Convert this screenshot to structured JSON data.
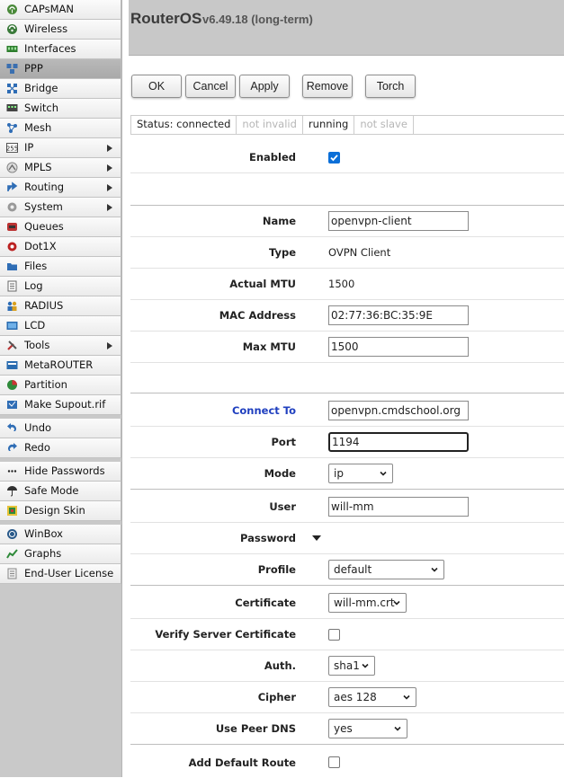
{
  "sidebar": {
    "groups": [
      [
        {
          "label": "CAPsMAN",
          "icon": "capsman-icon"
        },
        {
          "label": "Wireless",
          "icon": "wireless-icon"
        },
        {
          "label": "Interfaces",
          "icon": "interfaces-icon"
        },
        {
          "label": "PPP",
          "icon": "ppp-icon",
          "active": true
        },
        {
          "label": "Bridge",
          "icon": "bridge-icon"
        },
        {
          "label": "Switch",
          "icon": "switch-icon"
        },
        {
          "label": "Mesh",
          "icon": "mesh-icon"
        },
        {
          "label": "IP",
          "icon": "ip-icon",
          "submenu": true
        },
        {
          "label": "MPLS",
          "icon": "mpls-icon",
          "submenu": true
        },
        {
          "label": "Routing",
          "icon": "routing-icon",
          "submenu": true
        },
        {
          "label": "System",
          "icon": "system-icon",
          "submenu": true
        },
        {
          "label": "Queues",
          "icon": "queues-icon"
        },
        {
          "label": "Dot1X",
          "icon": "dot1x-icon"
        },
        {
          "label": "Files",
          "icon": "files-icon"
        },
        {
          "label": "Log",
          "icon": "log-icon"
        },
        {
          "label": "RADIUS",
          "icon": "radius-icon"
        },
        {
          "label": "LCD",
          "icon": "lcd-icon"
        },
        {
          "label": "Tools",
          "icon": "tools-icon",
          "submenu": true
        },
        {
          "label": "MetaROUTER",
          "icon": "metarouter-icon"
        },
        {
          "label": "Partition",
          "icon": "partition-icon"
        },
        {
          "label": "Make Supout.rif",
          "icon": "supout-icon"
        }
      ],
      [
        {
          "label": "Undo",
          "icon": "undo-icon"
        },
        {
          "label": "Redo",
          "icon": "redo-icon"
        }
      ],
      [
        {
          "label": "Hide Passwords",
          "icon": "hide-passwords-icon"
        },
        {
          "label": "Safe Mode",
          "icon": "safe-mode-icon"
        },
        {
          "label": "Design Skin",
          "icon": "design-skin-icon"
        }
      ],
      [
        {
          "label": "WinBox",
          "icon": "winbox-icon"
        },
        {
          "label": "Graphs",
          "icon": "graphs-icon"
        },
        {
          "label": "End-User License",
          "icon": "license-icon"
        }
      ]
    ]
  },
  "header": {
    "product": "RouterOS",
    "version": "v6.49.18 (long-term)"
  },
  "toolbar": {
    "ok": "OK",
    "cancel": "Cancel",
    "apply": "Apply",
    "remove": "Remove",
    "torch": "Torch"
  },
  "status": {
    "connected": "Status: connected",
    "invalid": "not invalid",
    "running": "running",
    "slave": "not slave"
  },
  "form": {
    "enabled_label": "Enabled",
    "name_label": "Name",
    "name_value": "openvpn-client",
    "type_label": "Type",
    "type_value": "OVPN Client",
    "mtu_label": "Actual MTU",
    "mtu_value": "1500",
    "mac_label": "MAC Address",
    "mac_value": "02:77:36:BC:35:9E",
    "maxmtu_label": "Max MTU",
    "maxmtu_value": "1500",
    "connect_label": "Connect To",
    "connect_value": "openvpn.cmdschool.org",
    "port_label": "Port",
    "port_value": "1194",
    "mode_label": "Mode",
    "mode_value": "ip",
    "user_label": "User",
    "user_value": "will-mm",
    "password_label": "Password",
    "profile_label": "Profile",
    "profile_value": "default",
    "cert_label": "Certificate",
    "cert_value": "will-mm.crt",
    "verify_label": "Verify Server Certificate",
    "auth_label": "Auth.",
    "auth_value": "sha1",
    "cipher_label": "Cipher",
    "cipher_value": "aes 128",
    "peerdns_label": "Use Peer DNS",
    "peerdns_value": "yes",
    "defroute_label": "Add Default Route"
  },
  "colors": {
    "sidebar_bg": "#c9c9c9",
    "header_bg": "#c8c8c8",
    "link_label": "#1f3fbf",
    "checkbox_checked": "#0b6fd8"
  }
}
